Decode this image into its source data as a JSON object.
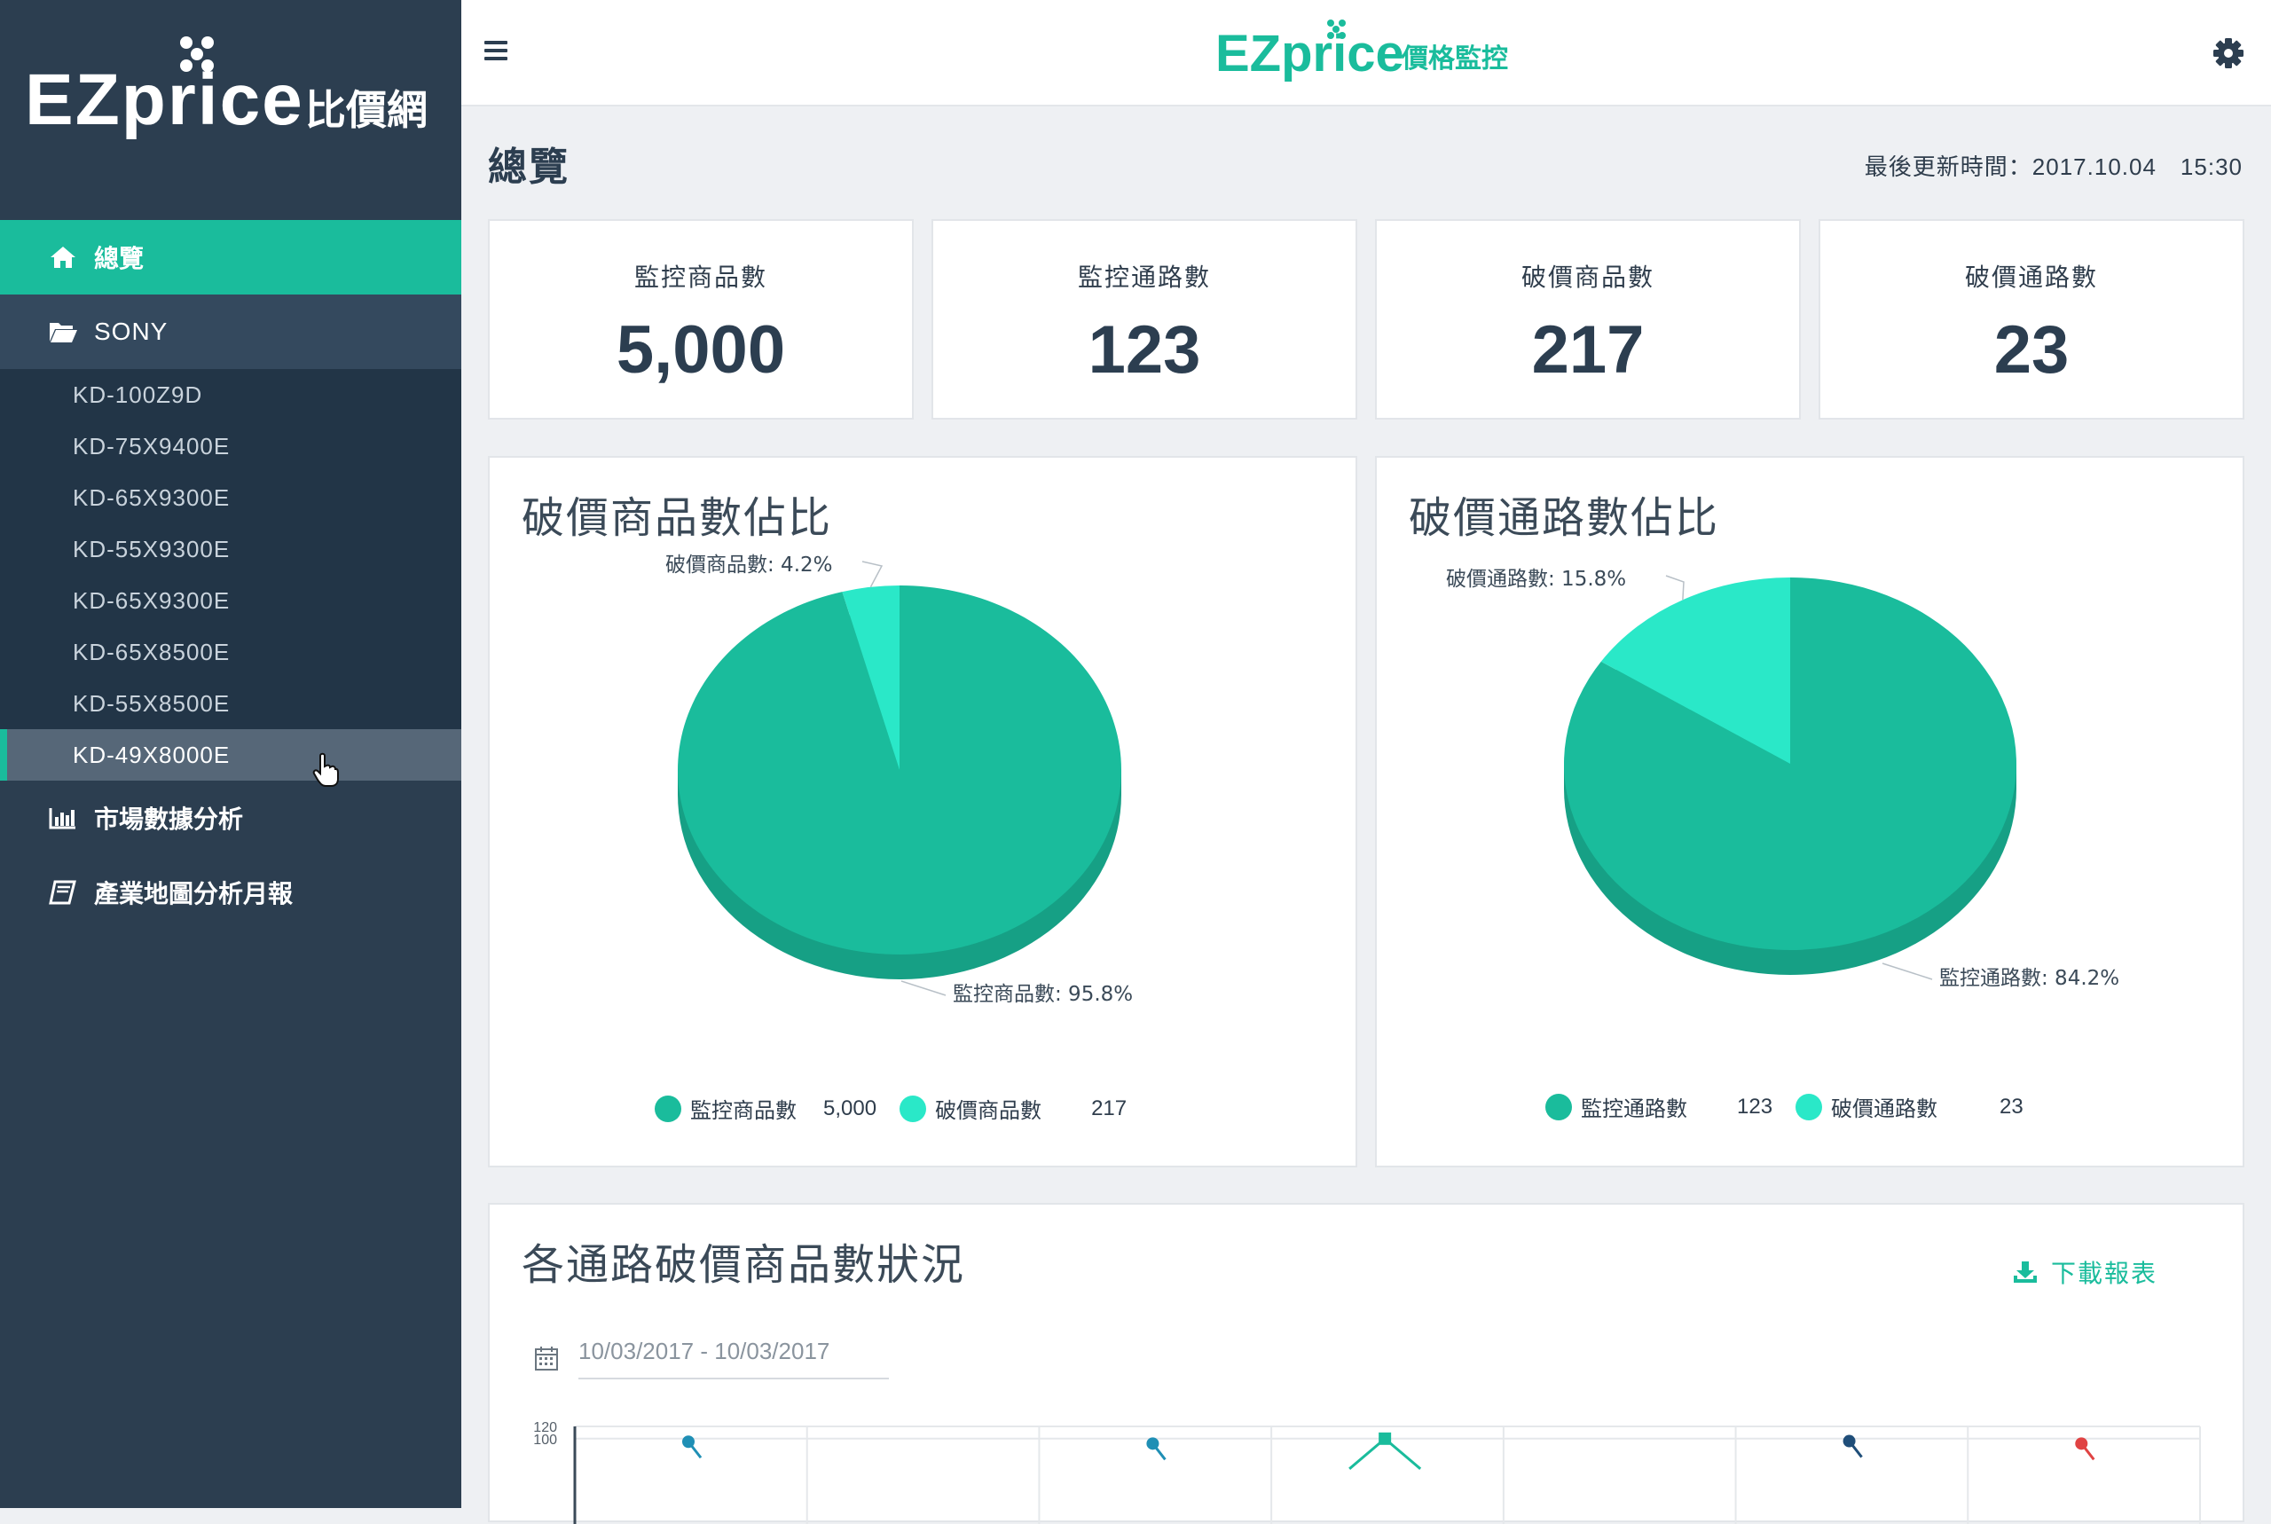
{
  "sidebar": {
    "brand": {
      "logo_text": "EZprice",
      "suffix": "比價網"
    },
    "overview": "總覽",
    "sony": "SONY",
    "sub_items": [
      "KD-100Z9D",
      "KD-75X9400E",
      "KD-65X9300E",
      "KD-55X9300E",
      "KD-65X9300E",
      "KD-65X8500E",
      "KD-55X8500E",
      "KD-49X8000E"
    ],
    "market": "市場數據分析",
    "report": "產業地圖分析月報"
  },
  "topbar": {
    "logo_text": "EZprice",
    "logo_suffix": "價格監控"
  },
  "page": {
    "title": "總覽",
    "updated": "最後更新時間：2017.10.04　15:30"
  },
  "stats": [
    {
      "label": "監控商品數",
      "value": "5,000"
    },
    {
      "label": "監控通路數",
      "value": "123"
    },
    {
      "label": "破價商品數",
      "value": "217"
    },
    {
      "label": "破價通路數",
      "value": "23"
    }
  ],
  "colors": {
    "primary": "#1abc9c",
    "primary_dark": "#16a085",
    "light": "#2ae8c8",
    "sidebar": "#2c3e50"
  },
  "chart_data": [
    {
      "type": "pie",
      "title": "破價商品數佔比",
      "series": [
        {
          "name": "監控商品數",
          "value": 5000,
          "percent": 95.8,
          "label": "監控商品數: 95.8%"
        },
        {
          "name": "破價商品數",
          "value": 217,
          "percent": 4.2,
          "label": "破價商品數: 4.2%"
        }
      ],
      "legend": {
        "a_name": "監控商品數",
        "a_value": "5,000",
        "b_name": "破價商品數",
        "b_value": "217"
      }
    },
    {
      "type": "pie",
      "title": "破價通路數佔比",
      "series": [
        {
          "name": "監控通路數",
          "value": 123,
          "percent": 84.2,
          "label": "監控通路數: 84.2%"
        },
        {
          "name": "破價通路數",
          "value": 23,
          "percent": 15.8,
          "label": "破價通路數: 15.8%"
        }
      ],
      "legend": {
        "a_name": "監控通路數",
        "a_value": "123",
        "b_name": "破價通路數",
        "b_value": "23"
      }
    },
    {
      "type": "line",
      "title": "各通路破價商品數狀況",
      "yticks": [
        "120",
        "100"
      ],
      "ylim": [
        0,
        120
      ],
      "points": [
        {
          "slot": 0,
          "y": 95,
          "color": "#1f8fb5"
        },
        {
          "slot": 2,
          "y": 92,
          "color": "#1f8fb5"
        },
        {
          "slot": 3,
          "y": 100,
          "color": "#1abc9c"
        },
        {
          "slot": 5,
          "y": 96,
          "color": "#1f4e79"
        },
        {
          "slot": 6,
          "y": 92,
          "color": "#e04343"
        }
      ]
    }
  ],
  "section": {
    "title": "各通路破價商品數狀況",
    "download": "下載報表",
    "date_range": "10/03/2017 - 10/03/2017"
  }
}
